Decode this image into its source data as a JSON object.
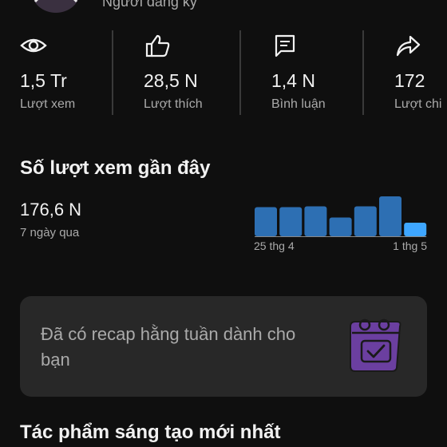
{
  "profile": {
    "subscriber_label": "Người đăng ký"
  },
  "stats": [
    {
      "icon": "eye-icon",
      "value": "1,5 Tr",
      "label": "Lượt xem"
    },
    {
      "icon": "thumbs-up-icon",
      "value": "28,5 N",
      "label": "Lượt thích"
    },
    {
      "icon": "comment-icon",
      "value": "1,4 N",
      "label": "Bình luận"
    },
    {
      "icon": "share-icon",
      "value": "172",
      "label": "Lượt chi"
    }
  ],
  "recent_views": {
    "title": "Số lượt xem gần đây",
    "value": "176,6 N",
    "period": "7 ngày qua"
  },
  "chart_data": {
    "type": "bar",
    "categories": [
      "25 thg 4",
      "",
      "",
      "",
      "",
      "",
      "1 thg 5"
    ],
    "values": [
      0.73,
      0.73,
      0.75,
      0.47,
      0.75,
      1.0,
      0.34
    ],
    "x_tick_labels": {
      "first": "25 thg 4",
      "last": "1 thg 5"
    },
    "colors": {
      "bar": "#2d6fb3",
      "highlight": "#3ea6ff",
      "baseline": "#8a8a8a"
    },
    "grid": false
  },
  "recap": {
    "text": "Đã có recap hằng tuần dành cho bạn",
    "icon": "calendar-check-icon",
    "icon_color": "#6b3fa0"
  },
  "latest": {
    "title": "Tác phẩm sáng tạo mới nhất"
  },
  "colors": {
    "background": "#0f0f0f",
    "card": "#282828",
    "text_primary": "#f1f1f1",
    "text_secondary": "#aaaaaa"
  }
}
